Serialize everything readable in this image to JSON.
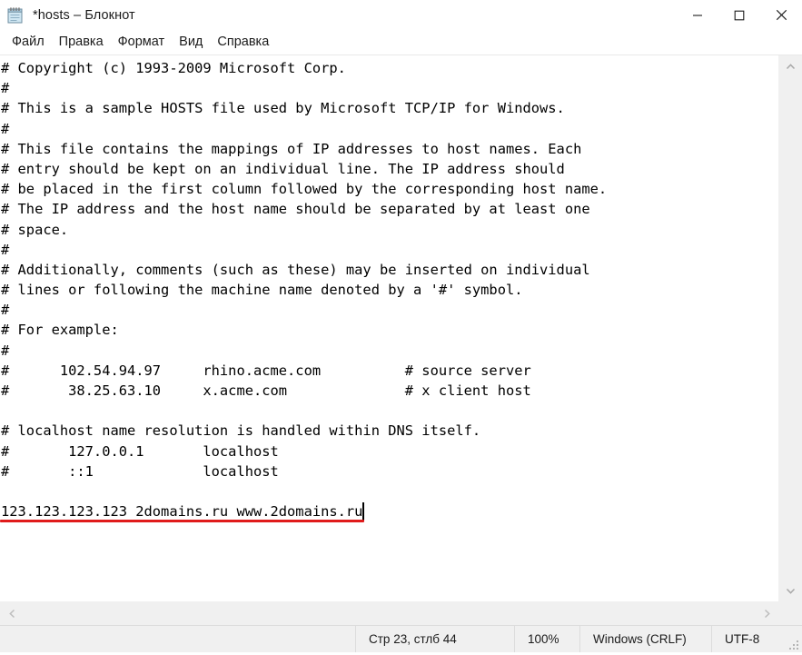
{
  "window": {
    "title": "*hosts – Блокнот",
    "icon": "notepad-icon",
    "controls": {
      "minimize": "minimize-icon",
      "maximize": "maximize-icon",
      "close": "close-icon"
    }
  },
  "menubar": {
    "items": [
      {
        "label": "Файл"
      },
      {
        "label": "Правка"
      },
      {
        "label": "Формат"
      },
      {
        "label": "Вид"
      },
      {
        "label": "Справка"
      }
    ]
  },
  "editor": {
    "lines": [
      "# Copyright (c) 1993-2009 Microsoft Corp.",
      "#",
      "# This is a sample HOSTS file used by Microsoft TCP/IP for Windows.",
      "#",
      "# This file contains the mappings of IP addresses to host names. Each",
      "# entry should be kept on an individual line. The IP address should",
      "# be placed in the first column followed by the corresponding host name.",
      "# The IP address and the host name should be separated by at least one",
      "# space.",
      "#",
      "# Additionally, comments (such as these) may be inserted on individual",
      "# lines or following the machine name denoted by a '#' symbol.",
      "#",
      "# For example:",
      "#",
      "#      102.54.94.97     rhino.acme.com          # source server",
      "#       38.25.63.10     x.acme.com              # x client host",
      "",
      "# localhost name resolution is handled within DNS itself.",
      "#       127.0.0.1       localhost",
      "#       ::1             localhost",
      "",
      "123.123.123.123 2domains.ru www.2domains.ru"
    ],
    "annotation_color": "#e01b1b",
    "caret_visible": true
  },
  "scrollbars": {
    "vertical": {
      "up": "chevron-up-icon",
      "down": "chevron-down-icon"
    },
    "horizontal": {
      "left": "chevron-left-icon",
      "right": "chevron-right-icon"
    }
  },
  "statusbar": {
    "position": "Стр 23, стлб 44",
    "zoom": "100%",
    "line_ending": "Windows (CRLF)",
    "encoding": "UTF-8"
  }
}
